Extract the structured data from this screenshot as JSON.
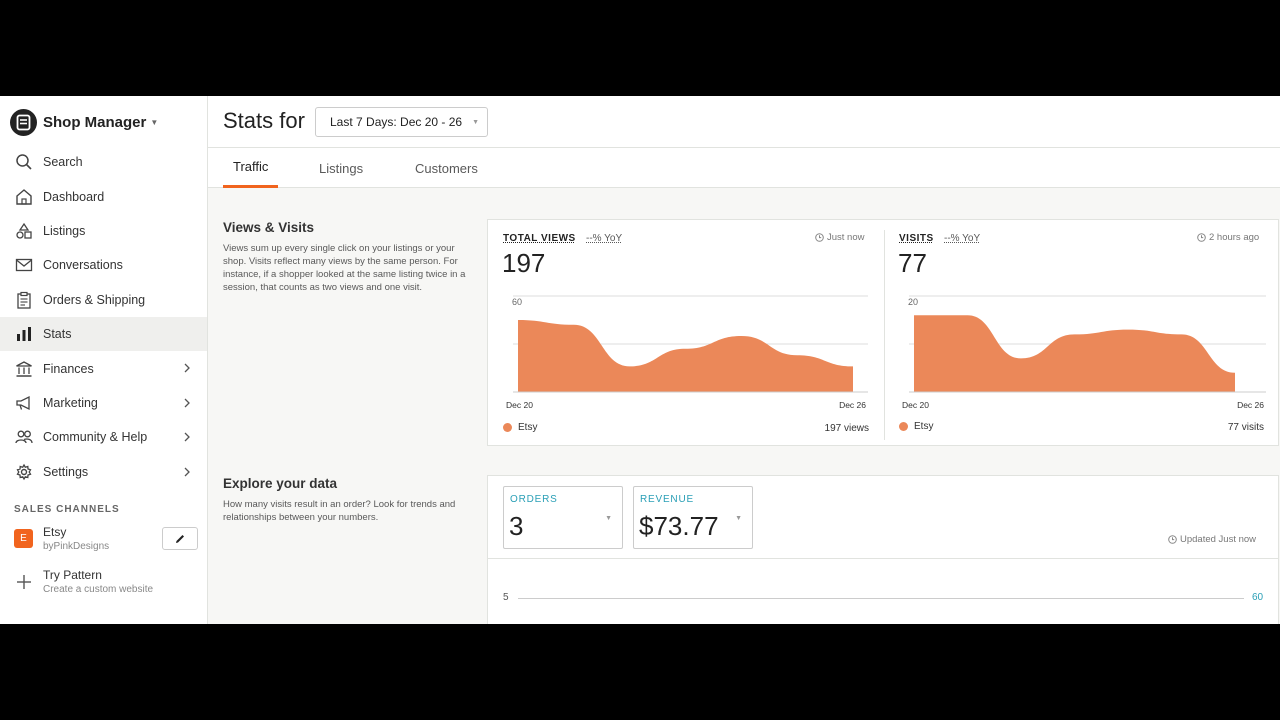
{
  "sidebar": {
    "title": "Shop Manager",
    "items": [
      {
        "label": "Search",
        "icon": "search-icon"
      },
      {
        "label": "Dashboard",
        "icon": "home-icon"
      },
      {
        "label": "Listings",
        "icon": "shapes-icon"
      },
      {
        "label": "Conversations",
        "icon": "envelope-icon"
      },
      {
        "label": "Orders & Shipping",
        "icon": "clipboard-icon"
      },
      {
        "label": "Stats",
        "icon": "bar-chart-icon",
        "active": true
      },
      {
        "label": "Finances",
        "icon": "bank-icon",
        "chevron": true
      },
      {
        "label": "Marketing",
        "icon": "megaphone-icon",
        "chevron": true
      },
      {
        "label": "Community & Help",
        "icon": "people-icon",
        "chevron": true
      },
      {
        "label": "Settings",
        "icon": "gear-icon",
        "chevron": true
      }
    ],
    "sales_channels_title": "SALES CHANNELS",
    "etsy_badge": "E",
    "etsy_name": "Etsy",
    "etsy_shop": "byPinkDesigns",
    "pattern_name": "Try Pattern",
    "pattern_sub": "Create a custom website"
  },
  "header": {
    "stats_for": "Stats for",
    "date_range": "Last 7 Days: Dec 20 - 26"
  },
  "tabs": [
    "Traffic",
    "Listings",
    "Customers"
  ],
  "views_visits": {
    "title": "Views & Visits",
    "description": "Views sum up every single click on your listings or your shop. Visits reflect many views by the same person. For instance, if a shopper looked at the same listing twice in a session, that counts as two views and one visit."
  },
  "total_views": {
    "label": "TOTAL VIEWS",
    "yoy": "--% YoY",
    "updated": "Just now",
    "value": "197",
    "legend": "Etsy",
    "total": "197 views"
  },
  "visits": {
    "label": "VISITS",
    "yoy": "--% YoY",
    "updated": "2 hours ago",
    "value": "77",
    "legend": "Etsy",
    "total": "77 visits"
  },
  "explore": {
    "title": "Explore your data",
    "description": "How many visits result in an order? Look for trends and relationships between your numbers.",
    "orders_label": "ORDERS",
    "orders_value": "3",
    "revenue_label": "REVENUE",
    "revenue_value": "$73.77",
    "updated": "Updated Just now",
    "left_axis": "5",
    "right_axis": "60"
  },
  "colors": {
    "accent": "#f1641e",
    "chart_fill": "#eb8859",
    "teal": "#2a9fb6"
  },
  "chart_data": [
    {
      "type": "area",
      "title": "TOTAL VIEWS",
      "x": [
        "Dec 20",
        "Dec 21",
        "Dec 22",
        "Dec 23",
        "Dec 24",
        "Dec 25",
        "Dec 26"
      ],
      "x_tick_labels": [
        "Dec 20",
        "Dec 26"
      ],
      "series": [
        {
          "name": "Etsy",
          "values": [
            45,
            42,
            16,
            27,
            35,
            23,
            16
          ]
        }
      ],
      "ylim": [
        0,
        60
      ],
      "y_tick_labels": [
        "60"
      ],
      "grid": true
    },
    {
      "type": "area",
      "title": "VISITS",
      "x": [
        "Dec 20",
        "Dec 21",
        "Dec 22",
        "Dec 23",
        "Dec 24",
        "Dec 25",
        "Dec 26"
      ],
      "x_tick_labels": [
        "Dec 20",
        "Dec 26"
      ],
      "series": [
        {
          "name": "Etsy",
          "values": [
            16,
            16,
            7,
            12,
            13,
            12,
            4
          ]
        }
      ],
      "ylim": [
        0,
        20
      ],
      "y_tick_labels": [
        "20"
      ],
      "grid": true
    }
  ]
}
